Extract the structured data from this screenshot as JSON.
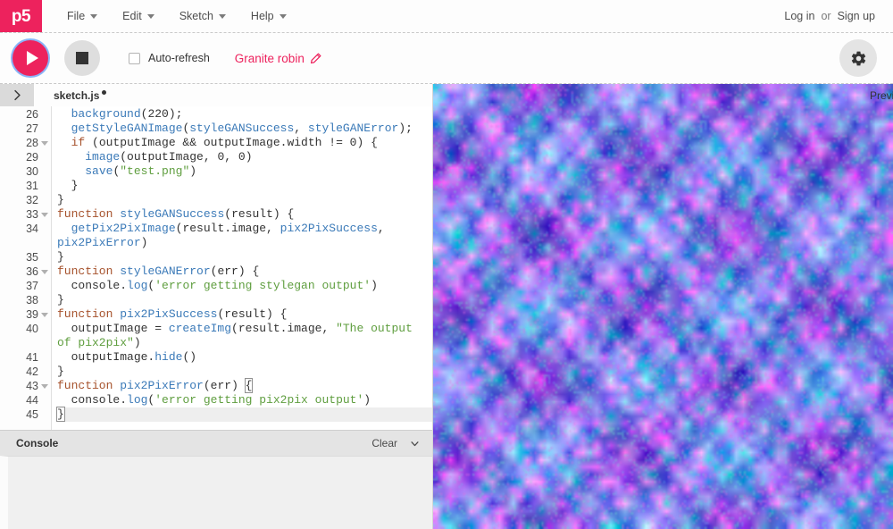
{
  "app": {
    "logo_text": "p5",
    "logo_star": "*",
    "brand_color": "#ed225d"
  },
  "nav": {
    "menus": [
      {
        "label": "File",
        "icon": "chevron-down-icon"
      },
      {
        "label": "Edit",
        "icon": "chevron-down-icon"
      },
      {
        "label": "Sketch",
        "icon": "chevron-down-icon"
      },
      {
        "label": "Help",
        "icon": "chevron-down-icon"
      }
    ],
    "login_label": "Log in",
    "or_label": "or",
    "signup_label": "Sign up"
  },
  "toolbar": {
    "play_icon": "play-icon",
    "stop_icon": "stop-icon",
    "autorefresh_label": "Auto-refresh",
    "autorefresh_checked": false,
    "project_name": "Granite robin",
    "edit_icon": "pencil-icon",
    "settings_icon": "gear-icon"
  },
  "editor": {
    "sidebar_toggle_icon": "chevron-right-icon",
    "filename": "sketch.js",
    "unsaved": true,
    "preview_label": "Preview",
    "first_visible_line": 26,
    "last_line": 45,
    "active_line": 45,
    "lines": [
      {
        "n": 26,
        "fold": false,
        "clipped": true,
        "tokens": [
          {
            "t": "  ",
            "c": "pl"
          },
          {
            "t": "background",
            "c": "fn"
          },
          {
            "t": "(",
            "c": "pl"
          },
          {
            "t": "220",
            "c": "num"
          },
          {
            "t": ");",
            "c": "pl"
          }
        ]
      },
      {
        "n": 27,
        "fold": false,
        "tokens": [
          {
            "t": "  ",
            "c": "pl"
          },
          {
            "t": "getStyleGANImage",
            "c": "fn"
          },
          {
            "t": "(",
            "c": "pl"
          },
          {
            "t": "styleGANSuccess",
            "c": "fn"
          },
          {
            "t": ", ",
            "c": "pl"
          },
          {
            "t": "styleGANError",
            "c": "fn"
          },
          {
            "t": ");",
            "c": "pl"
          }
        ]
      },
      {
        "n": 28,
        "fold": true,
        "tokens": [
          {
            "t": "  ",
            "c": "pl"
          },
          {
            "t": "if",
            "c": "kw"
          },
          {
            "t": " (outputImage && outputImage.width != ",
            "c": "pl"
          },
          {
            "t": "0",
            "c": "num"
          },
          {
            "t": ") {",
            "c": "pl"
          }
        ]
      },
      {
        "n": 29,
        "fold": false,
        "tokens": [
          {
            "t": "    ",
            "c": "pl"
          },
          {
            "t": "image",
            "c": "fn"
          },
          {
            "t": "(outputImage, ",
            "c": "pl"
          },
          {
            "t": "0",
            "c": "num"
          },
          {
            "t": ", ",
            "c": "pl"
          },
          {
            "t": "0",
            "c": "num"
          },
          {
            "t": ")",
            "c": "pl"
          }
        ]
      },
      {
        "n": 30,
        "fold": false,
        "tokens": [
          {
            "t": "    ",
            "c": "pl"
          },
          {
            "t": "save",
            "c": "fn"
          },
          {
            "t": "(",
            "c": "pl"
          },
          {
            "t": "\"test.png\"",
            "c": "str"
          },
          {
            "t": ")",
            "c": "pl"
          }
        ]
      },
      {
        "n": 31,
        "fold": false,
        "tokens": [
          {
            "t": "  }",
            "c": "pl"
          }
        ]
      },
      {
        "n": 32,
        "fold": false,
        "tokens": [
          {
            "t": "}",
            "c": "pl"
          }
        ]
      },
      {
        "n": 33,
        "fold": true,
        "tokens": [
          {
            "t": "function",
            "c": "kw"
          },
          {
            "t": " ",
            "c": "pl"
          },
          {
            "t": "styleGANSuccess",
            "c": "fn"
          },
          {
            "t": "(result) {",
            "c": "pl"
          }
        ]
      },
      {
        "n": 34,
        "fold": false,
        "tokens": [
          {
            "t": "  ",
            "c": "pl"
          },
          {
            "t": "getPix2PixImage",
            "c": "fn"
          },
          {
            "t": "(result.image, ",
            "c": "pl"
          },
          {
            "t": "pix2PixSuccess",
            "c": "fn"
          },
          {
            "t": ",",
            "c": "pl"
          }
        ]
      },
      {
        "n": null,
        "wrap": true,
        "fold": false,
        "tokens": [
          {
            "t": "pix2PixError",
            "c": "fn"
          },
          {
            "t": ")",
            "c": "pl"
          }
        ]
      },
      {
        "n": 35,
        "fold": false,
        "tokens": [
          {
            "t": "}",
            "c": "pl"
          }
        ]
      },
      {
        "n": 36,
        "fold": true,
        "tokens": [
          {
            "t": "function",
            "c": "kw"
          },
          {
            "t": " ",
            "c": "pl"
          },
          {
            "t": "styleGANError",
            "c": "fn"
          },
          {
            "t": "(err) {",
            "c": "pl"
          }
        ]
      },
      {
        "n": 37,
        "fold": false,
        "tokens": [
          {
            "t": "  console.",
            "c": "pl"
          },
          {
            "t": "log",
            "c": "fn"
          },
          {
            "t": "(",
            "c": "pl"
          },
          {
            "t": "'error getting stylegan output'",
            "c": "str"
          },
          {
            "t": ")",
            "c": "pl"
          }
        ]
      },
      {
        "n": 38,
        "fold": false,
        "tokens": [
          {
            "t": "}",
            "c": "pl"
          }
        ]
      },
      {
        "n": 39,
        "fold": true,
        "tokens": [
          {
            "t": "function",
            "c": "kw"
          },
          {
            "t": " ",
            "c": "pl"
          },
          {
            "t": "pix2PixSuccess",
            "c": "fn"
          },
          {
            "t": "(result) {",
            "c": "pl"
          }
        ]
      },
      {
        "n": 40,
        "fold": false,
        "tokens": [
          {
            "t": "  outputImage = ",
            "c": "pl"
          },
          {
            "t": "createImg",
            "c": "fn"
          },
          {
            "t": "(result.image, ",
            "c": "pl"
          },
          {
            "t": "\"The output",
            "c": "str"
          }
        ]
      },
      {
        "n": null,
        "wrap": true,
        "fold": false,
        "tokens": [
          {
            "t": "of pix2pix\"",
            "c": "str"
          },
          {
            "t": ")",
            "c": "pl"
          }
        ]
      },
      {
        "n": 41,
        "fold": false,
        "tokens": [
          {
            "t": "  outputImage.",
            "c": "pl"
          },
          {
            "t": "hide",
            "c": "fn"
          },
          {
            "t": "()",
            "c": "pl"
          }
        ]
      },
      {
        "n": 42,
        "fold": false,
        "tokens": [
          {
            "t": "}",
            "c": "pl"
          }
        ]
      },
      {
        "n": 43,
        "fold": true,
        "tokens": [
          {
            "t": "function",
            "c": "kw"
          },
          {
            "t": " ",
            "c": "pl"
          },
          {
            "t": "pix2PixError",
            "c": "fn"
          },
          {
            "t": "(err) ",
            "c": "pl"
          },
          {
            "t": "{",
            "c": "pl",
            "match": true
          }
        ]
      },
      {
        "n": 44,
        "fold": false,
        "tokens": [
          {
            "t": "  console.",
            "c": "pl"
          },
          {
            "t": "log",
            "c": "fn"
          },
          {
            "t": "(",
            "c": "pl"
          },
          {
            "t": "'error getting pix2pix output'",
            "c": "str"
          },
          {
            "t": ")",
            "c": "pl"
          }
        ]
      },
      {
        "n": 45,
        "fold": false,
        "active": true,
        "tokens": [
          {
            "t": "}",
            "c": "pl",
            "match": true
          }
        ]
      }
    ]
  },
  "console": {
    "title": "Console",
    "clear_label": "Clear",
    "collapse_icon": "chevron-down-icon",
    "messages": []
  },
  "preview": {
    "description": "noisy generative texture output",
    "palette": [
      "#7b6ee8",
      "#9a7ef0",
      "#6fb3e8",
      "#d66fd6",
      "#6fe0c0",
      "#b07ce8",
      "#5fa8e0",
      "#e07ad0"
    ],
    "base_color": "#8a7ae8"
  }
}
